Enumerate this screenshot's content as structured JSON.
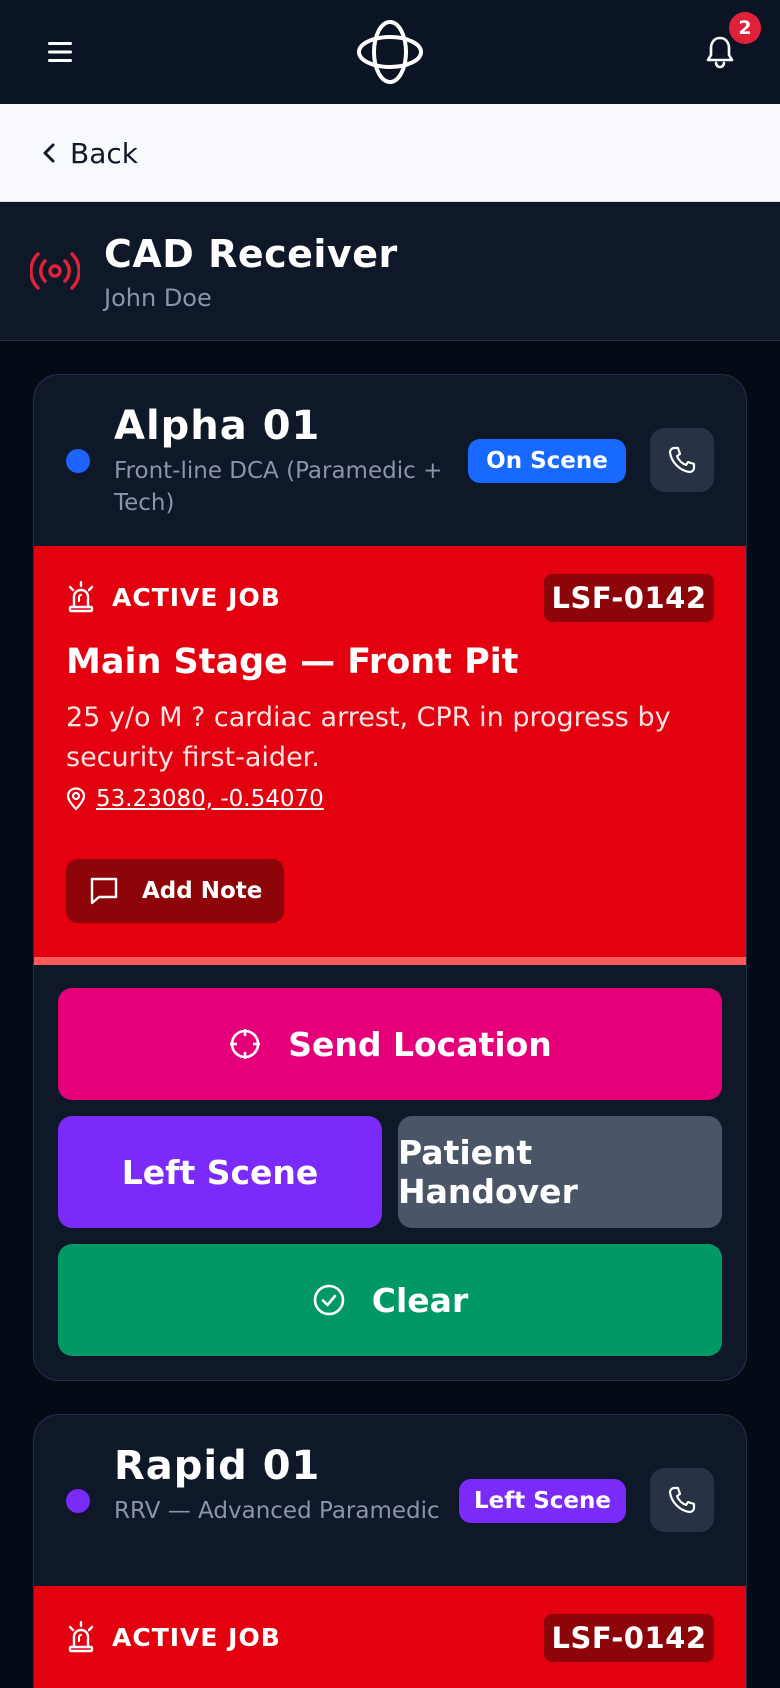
{
  "topbar": {
    "menu_icon": "hamburger-icon",
    "logo_icon": "orbit-logo",
    "notification_icon": "bell-icon",
    "notification_count": "2"
  },
  "backbar": {
    "label": "Back",
    "icon": "chevron-left-icon"
  },
  "header": {
    "title": "CAD Receiver",
    "subtitle": "John Doe",
    "icon": "broadcast-icon",
    "icon_color": "#e0213a"
  },
  "units": [
    {
      "name": "Alpha 01",
      "description": "Front-line DCA (Paramedic + Tech)",
      "status": "On Scene",
      "status_color": "#1769ff",
      "dot_color": "#1f63ff",
      "job": {
        "header": "ACTIVE JOB",
        "id": "LSF-0142",
        "location": "Main Stage — Front Pit",
        "description": "25 y/o M ? cardiac arrest, CPR in progress by security first-aider.",
        "coords": "53.23080, -0.54070",
        "add_note_label": "Add Note"
      },
      "actions": {
        "send_location": "Send Location",
        "left_scene": "Left Scene",
        "patient_handover": "Patient Handover",
        "clear": "Clear"
      }
    },
    {
      "name": "Rapid 01",
      "description": "RRV — Advanced Paramedic",
      "status": "Left Scene",
      "status_color": "#7b2bf9",
      "dot_color": "#7b2bf9",
      "job": {
        "header": "ACTIVE JOB",
        "id": "LSF-0142"
      }
    }
  ],
  "colors": {
    "send_location": "#e5007a",
    "left_scene": "#7b2bf9",
    "patient_handover": "#4a5568",
    "clear": "#009966",
    "job_panel": "#e3000f"
  }
}
